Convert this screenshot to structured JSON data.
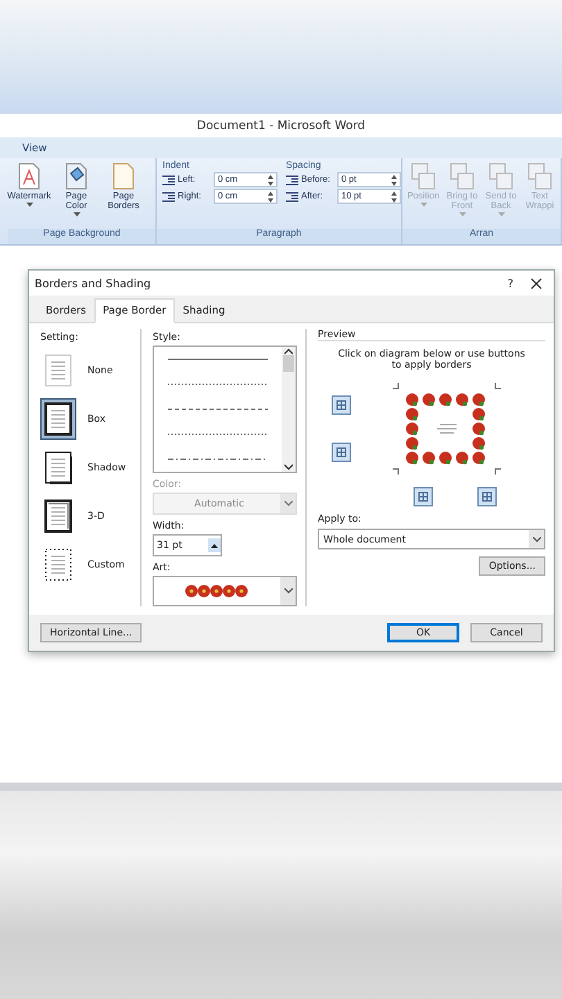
{
  "window": {
    "title": "Document1 - Microsoft Word"
  },
  "menu": [
    {
      "label": "View",
      "selected": false
    }
  ],
  "ribbon": {
    "page_background": {
      "label": "Page Background",
      "buttons": [
        {
          "label": "Watermark",
          "kind": "watermark",
          "dropdown": true
        },
        {
          "label": "Page Color",
          "kind": "color",
          "dropdown": true
        },
        {
          "label": "Page Borders",
          "kind": "borders",
          "dropdown": false
        }
      ]
    },
    "paragraph": {
      "label": "Paragraph",
      "indent": {
        "title": "Indent",
        "fields": [
          {
            "label": "Left:",
            "value": "0 cm"
          },
          {
            "label": "Right:",
            "value": "0 cm"
          }
        ]
      },
      "spacing": {
        "title": "Spacing",
        "fields": [
          {
            "label": "Before:",
            "value": "0 pt"
          },
          {
            "label": "After:",
            "value": "10 pt"
          }
        ]
      }
    },
    "arrange": {
      "label": "Arran",
      "buttons": [
        {
          "label": "Position",
          "dropdown": true,
          "disabled": true
        },
        {
          "label": "Bring to Front",
          "dropdown": true,
          "disabled": true
        },
        {
          "label": "Send to Back",
          "dropdown": true,
          "disabled": true
        },
        {
          "label": "Text Wrappi",
          "dropdown": false,
          "disabled": true
        }
      ]
    }
  },
  "dialog": {
    "title": "Borders and Shading",
    "help": "?",
    "tabs": [
      {
        "label": "Borders",
        "selected": false
      },
      {
        "label": "Page Border",
        "selected": true
      },
      {
        "label": "Shading",
        "selected": false
      }
    ],
    "setting": {
      "label": "Setting:",
      "items": [
        {
          "label": "None",
          "kind": "none",
          "selected": false
        },
        {
          "label": "Box",
          "kind": "box",
          "selected": true
        },
        {
          "label": "Shadow",
          "kind": "shadow",
          "selected": false
        },
        {
          "label": "3-D",
          "kind": "threed",
          "selected": false
        },
        {
          "label": "Custom",
          "kind": "custom",
          "selected": false
        }
      ]
    },
    "style": {
      "label": "Style:",
      "lines": [
        {
          "kind": "solid"
        },
        {
          "kind": "dotted"
        },
        {
          "kind": "dashed"
        },
        {
          "kind": "dotted"
        },
        {
          "kind": "dashdot"
        }
      ]
    },
    "color": {
      "label": "Color:",
      "value": "Automatic",
      "disabled": true
    },
    "width": {
      "label": "Width:",
      "value": "31 pt"
    },
    "art": {
      "label": "Art:"
    },
    "preview": {
      "title": "Preview",
      "hint": "Click on diagram below or use buttons to apply borders"
    },
    "apply_to": {
      "label": "Apply to:",
      "value": "Whole document"
    },
    "options_button": "Options...",
    "horizontal_line_button": "Horizontal Line...",
    "buttons": [
      {
        "label": "OK",
        "default": true
      },
      {
        "label": "Cancel",
        "default": false
      }
    ]
  }
}
